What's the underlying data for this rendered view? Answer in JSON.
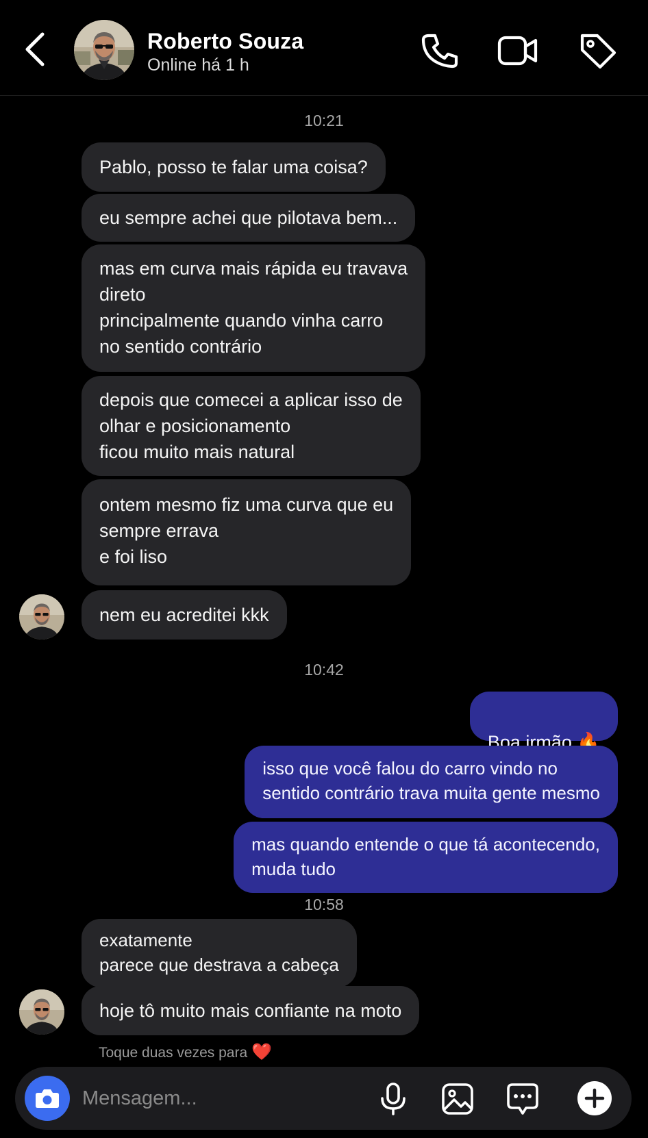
{
  "header": {
    "name": "Roberto Souza",
    "status": "Online há 1 h",
    "icons": [
      "back-icon",
      "phone-icon",
      "video-icon",
      "tag-icon"
    ]
  },
  "timestamps": [
    "10:21",
    "10:42",
    "10:58"
  ],
  "messages": [
    {
      "side": "in",
      "text": "Pablo, posso te falar uma coisa?"
    },
    {
      "side": "in",
      "text": "eu sempre achei que pilotava bem..."
    },
    {
      "side": "in",
      "text": "mas em curva mais rápida eu travava\ndireto\nprincipalmente quando vinha carro\nno sentido contrário"
    },
    {
      "side": "in",
      "text": "depois que comecei a aplicar isso de\nolhar e posicionamento\nficou muito mais natural"
    },
    {
      "side": "in",
      "text": "ontem mesmo fiz uma curva que eu\nsempre errava\ne foi liso"
    },
    {
      "side": "in",
      "text": "nem eu acreditei kkk"
    },
    {
      "side": "out",
      "text": "Boa irmão 🔥"
    },
    {
      "side": "out",
      "text": "isso que você falou do carro vindo no\nsentido contrário trava muita gente mesmo"
    },
    {
      "side": "out",
      "text": "mas quando entende o que tá acontecendo,\nmuda tudo"
    },
    {
      "side": "in",
      "text": "exatamente\nparece que destrava a cabeça"
    },
    {
      "side": "in",
      "text": "hoje tô muito mais confiante na moto"
    }
  ],
  "hint": {
    "text": "Toque duas vezes para",
    "emoji": "❤️"
  },
  "composer": {
    "placeholder": "Mensagem...",
    "icons": [
      "camera-icon",
      "microphone-icon",
      "image-icon",
      "chat-bubble-icon",
      "plus-icon"
    ]
  },
  "colors": {
    "background": "#000000",
    "incoming_bubble": "#262629",
    "outgoing_bubble": "#2e2e95",
    "camera_button": "#3b6cf0"
  }
}
